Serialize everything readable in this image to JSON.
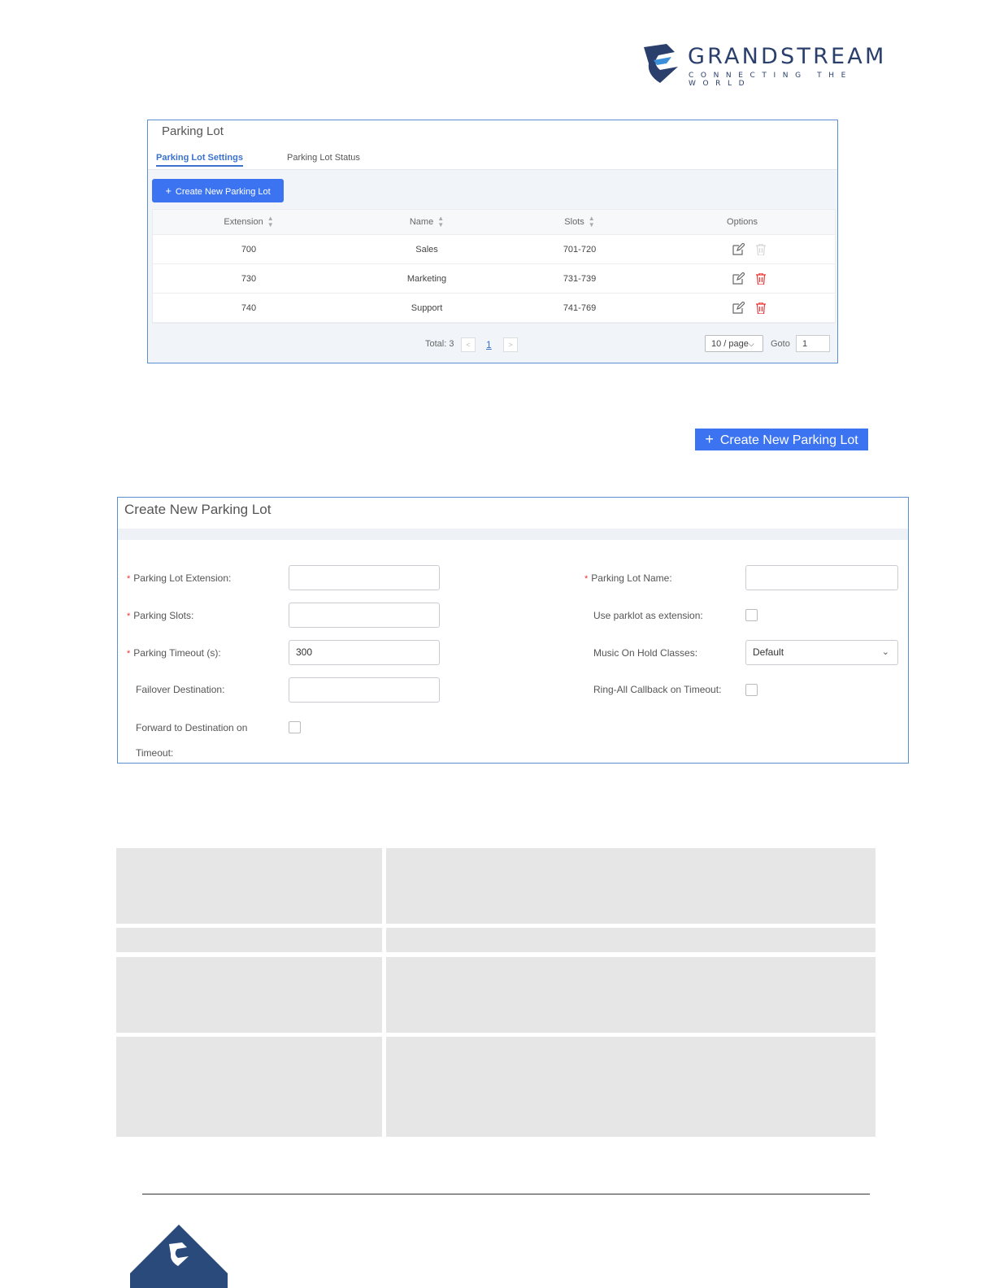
{
  "logo": {
    "word": "GRANDSTREAM",
    "tagline": "CONNECTING THE WORLD",
    "primary_color": "#2a3f6b"
  },
  "parking_lot_panel": {
    "title": "Parking Lot",
    "tabs": [
      {
        "label": "Parking Lot Settings",
        "active": true
      },
      {
        "label": "Parking Lot Status",
        "active": false
      }
    ],
    "create_button": "Create New Parking Lot",
    "columns": [
      "Extension",
      "Name",
      "Slots",
      "Options"
    ],
    "rows": [
      {
        "extension": "700",
        "name": "Sales",
        "slots": "701-720",
        "delete_enabled": false
      },
      {
        "extension": "730",
        "name": "Marketing",
        "slots": "731-739",
        "delete_enabled": true
      },
      {
        "extension": "740",
        "name": "Support",
        "slots": "741-769",
        "delete_enabled": true
      }
    ],
    "pagination": {
      "total": "Total: 3",
      "current_page": "1",
      "page_size": "10 / page",
      "goto_label": "Goto",
      "goto_value": "1"
    }
  },
  "standalone_button": {
    "label": "Create New Parking Lot"
  },
  "create_form": {
    "title": "Create New Parking Lot",
    "fields": {
      "extension_label": "Parking Lot Extension",
      "slots_label": "Parking Slots",
      "timeout_label": "Parking Timeout (s)",
      "timeout_value": "300",
      "failover_label": "Failover Destination",
      "forward_label_1": "Forward to Destination on",
      "forward_label_2": "Timeout",
      "name_label": "Parking Lot Name",
      "use_parklot_label": "Use parklot as extension",
      "moh_label": "Music On Hold Classes",
      "moh_value": "Default",
      "ring_all_label": "Ring-All Callback on Timeout"
    },
    "colon": ":"
  },
  "colors": {
    "accent": "#3b73f0",
    "panel_border": "#5a8fd0",
    "delete": "#e33",
    "grey_cell": "#e6e6e6"
  }
}
